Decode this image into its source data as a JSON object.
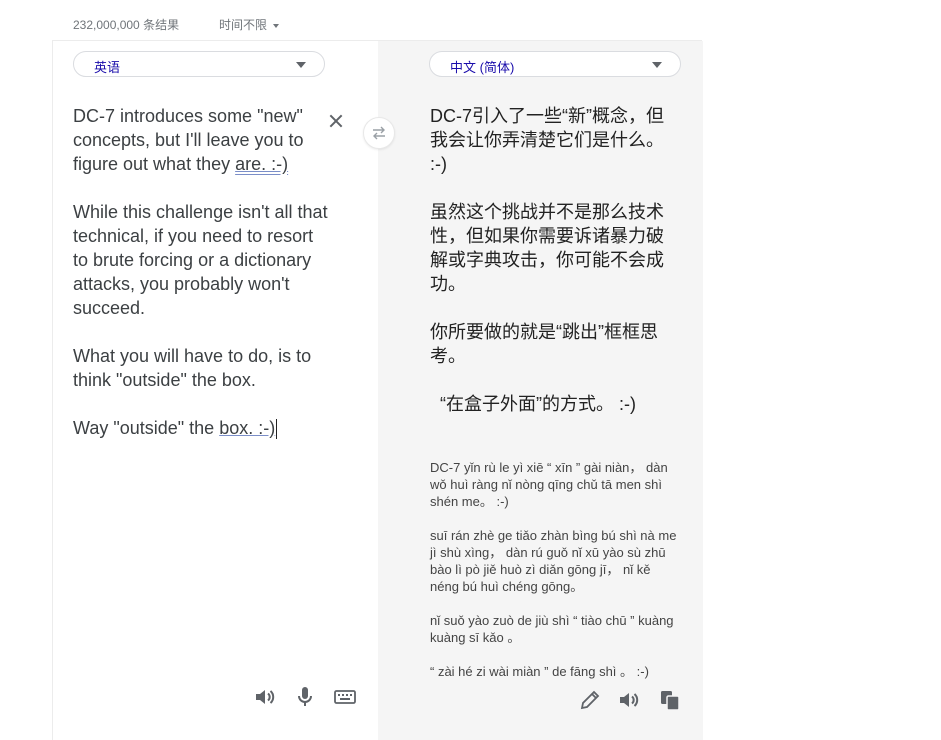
{
  "top": {
    "results": "232,000,000 条结果",
    "time_filter": "时间不限"
  },
  "source": {
    "language": "英语",
    "paragraphs": [
      [
        "DC-7 introduces some \"new\" concepts, but I'll leave you to figure out what they ",
        "are.  :-)"
      ],
      [
        "While this challenge isn't all that technical, if you need to resort to brute forcing or a dictionary attacks, you probably won't succeed."
      ],
      [
        "What you will have to do, is to think \"outside\" the box."
      ],
      [
        "Way \"outside\" the ",
        "box.  :-)"
      ]
    ]
  },
  "target": {
    "language": "中文 (简体)",
    "paragraphs": [
      "DC-7引入了一些“新”概念，但我会让你弄清楚它们是什么。 :-)",
      "虽然这个挑战并不是那么技术性，但如果你需要诉诸暴力破解或字典攻击，你可能不会成功。",
      "你所要做的就是“跳出”框框思考。",
      "“在盒子外面”的方式。 :-)"
    ],
    "pinyin": [
      "DC-7 yǐn rù le yì xiē “ xīn ” gài niàn， dàn wǒ huì ràng nǐ nòng qīng chǔ tā men shì shén me。 :-)",
      "suī rán zhè ge tiǎo zhàn bìng bú shì nà me jì shù xìng， dàn rú guǒ nǐ xū yào sù zhū bào lì pò jiě huò zì diǎn gōng jī， nǐ kě néng bú huì chéng gōng。",
      "nǐ suǒ yào zuò de jiù shì “ tiào chū ” kuàng kuàng sī kǎo 。",
      "“ zài hé zi wài miàn ” de fāng shì 。 :-)"
    ]
  },
  "icons": {
    "clear": "close-icon",
    "swap": "swap-arrows-icon",
    "source_speak": "speaker-icon",
    "mic": "microphone-icon",
    "keyboard": "keyboard-icon",
    "edit": "pencil-icon",
    "target_speak": "speaker-icon",
    "copy": "copy-icon"
  }
}
